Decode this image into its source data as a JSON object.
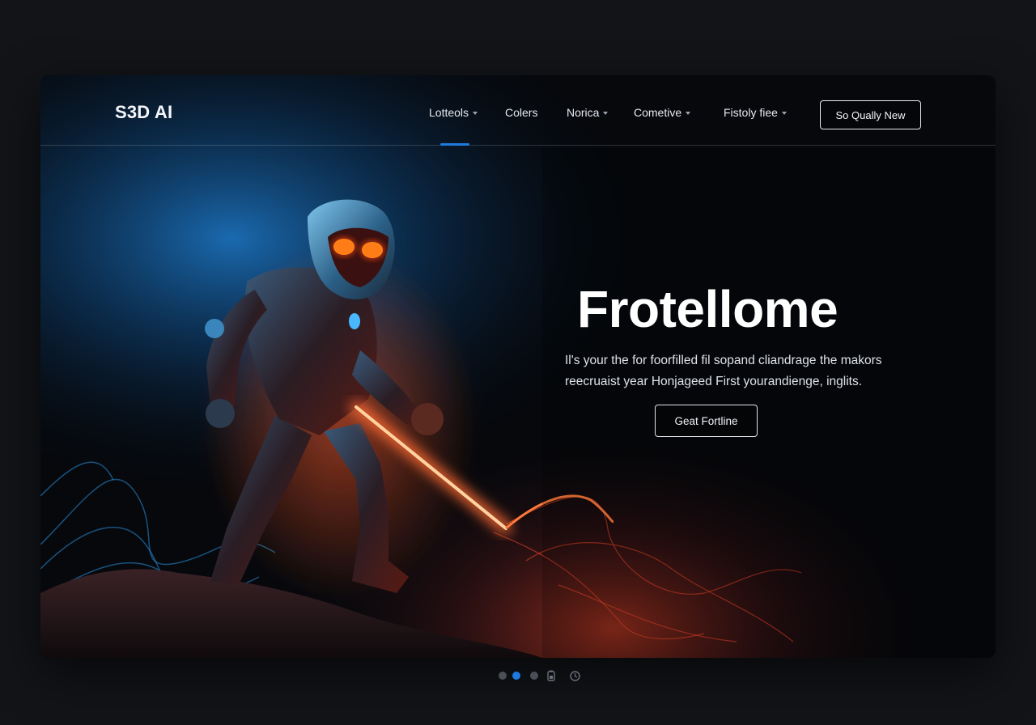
{
  "header": {
    "logo": "S3D AI",
    "nav": [
      {
        "label": "Lotteols",
        "has_dropdown": true
      },
      {
        "label": "Colers",
        "has_dropdown": false
      },
      {
        "label": "Norica",
        "has_dropdown": true
      },
      {
        "label": "Cometive",
        "has_dropdown": true
      },
      {
        "label": "Fistoly fiee",
        "has_dropdown": true
      }
    ],
    "active_nav_index": 0,
    "cta_label": "So Qually New"
  },
  "hero": {
    "title": "Frotellome",
    "description": "Il's your the for foorfilled fil sopand cliandrage the makors reecruaist year Honjageed First yourandienge, inglits.",
    "button_label": "Geat Fortline"
  },
  "pager": {
    "dot_count": 3,
    "active_index": 1,
    "icons": [
      "battery-icon",
      "clock-icon"
    ]
  },
  "colors": {
    "accent": "#1f7ae0",
    "page_bg": "#121418",
    "glow_red": "#ff3a1a",
    "glow_blue": "#1e90ff"
  }
}
